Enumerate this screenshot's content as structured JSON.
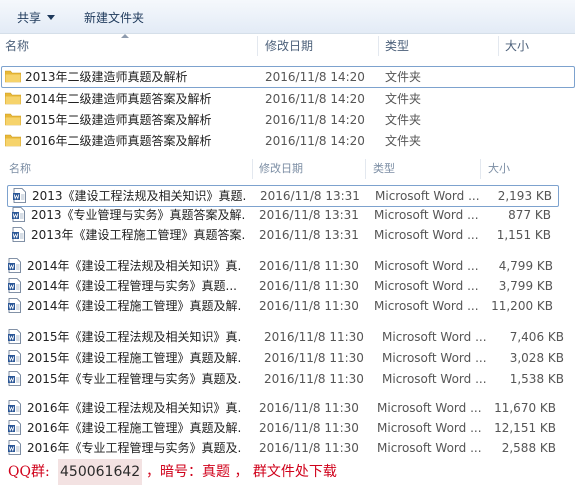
{
  "toolbar": {
    "share_label": "共享",
    "new_folder_label": "新建文件夹"
  },
  "header_top": {
    "name": "名称",
    "date": "修改日期",
    "type": "类型",
    "size": "大小"
  },
  "folders": [
    {
      "name": "2013年二级建造师真题及解析",
      "date": "2016/11/8 14:20",
      "type": "文件夹"
    },
    {
      "name": "2014年二级建造师真题答案及解析",
      "date": "2016/11/8 14:20",
      "type": "文件夹"
    },
    {
      "name": "2015年二级建造师真题答案及解析",
      "date": "2016/11/8 14:20",
      "type": "文件夹"
    },
    {
      "name": "2016年二级建造师真题答案及解析",
      "date": "2016/11/8 14:20",
      "type": "文件夹"
    }
  ],
  "header_files": {
    "name": "名称",
    "date": "修改日期",
    "type": "类型",
    "size": "大小"
  },
  "files_2013": [
    {
      "name": "2013《建设工程法规及相关知识》真题...",
      "date": "2016/11/8 13:31",
      "type": "Microsoft Word ...",
      "size": "2,193 KB"
    },
    {
      "name": "2013《专业管理与实务》真题答案及解...",
      "date": "2016/11/8 13:31",
      "type": "Microsoft Word ...",
      "size": "877 KB"
    },
    {
      "name": "2013年《建设工程施工管理》真题答案...",
      "date": "2016/11/8 13:31",
      "type": "Microsoft Word ...",
      "size": "1,151 KB"
    }
  ],
  "files_2014": [
    {
      "name": "2014年《建设工程法规及相关知识》真...",
      "date": "2016/11/8 11:30",
      "type": "Microsoft Word ...",
      "size": "4,799 KB"
    },
    {
      "name": "2014年《建设工程管理与实务》真题...",
      "date": "2016/11/8 11:30",
      "type": "Microsoft Word ...",
      "size": "3,799 KB"
    },
    {
      "name": "2014年《建设工程施工管理》真题及解...",
      "date": "2016/11/8 11:30",
      "type": "Microsoft Word ...",
      "size": "11,200 KB"
    }
  ],
  "files_2015": [
    {
      "name": "2015年《建设工程法规及相关知识》真...",
      "date": "2016/11/8 11:30",
      "type": "Microsoft Word ...",
      "size": "7,406 KB"
    },
    {
      "name": "2015年《建设工程施工管理》真题及解...",
      "date": "2016/11/8 11:30",
      "type": "Microsoft Word ...",
      "size": "3,028 KB"
    },
    {
      "name": "2015年《专业工程管理与实务》真题及...",
      "date": "2016/11/8 11:30",
      "type": "Microsoft Word ...",
      "size": "1,538 KB"
    }
  ],
  "files_2016": [
    {
      "name": "2016年《建设工程法规及相关知识》真...",
      "date": "2016/11/8 11:30",
      "type": "Microsoft Word ...",
      "size": "11,670 KB"
    },
    {
      "name": "2016年《建设工程施工管理》真题及解...",
      "date": "2016/11/8 11:30",
      "type": "Microsoft Word ...",
      "size": "12,151 KB"
    },
    {
      "name": "2016年《专业工程管理与实务》真题及...",
      "date": "2016/11/8 11:30",
      "type": "Microsoft Word ...",
      "size": "2,588 KB"
    }
  ],
  "footer": {
    "qq_label": "QQ群:",
    "qq_number": "450061642",
    "rest": "，暗号：真题 ， 群文件处下载"
  },
  "colors": {
    "accent": "#1e395b",
    "footer_red": "#d0021b",
    "folder": "#e8b838"
  }
}
